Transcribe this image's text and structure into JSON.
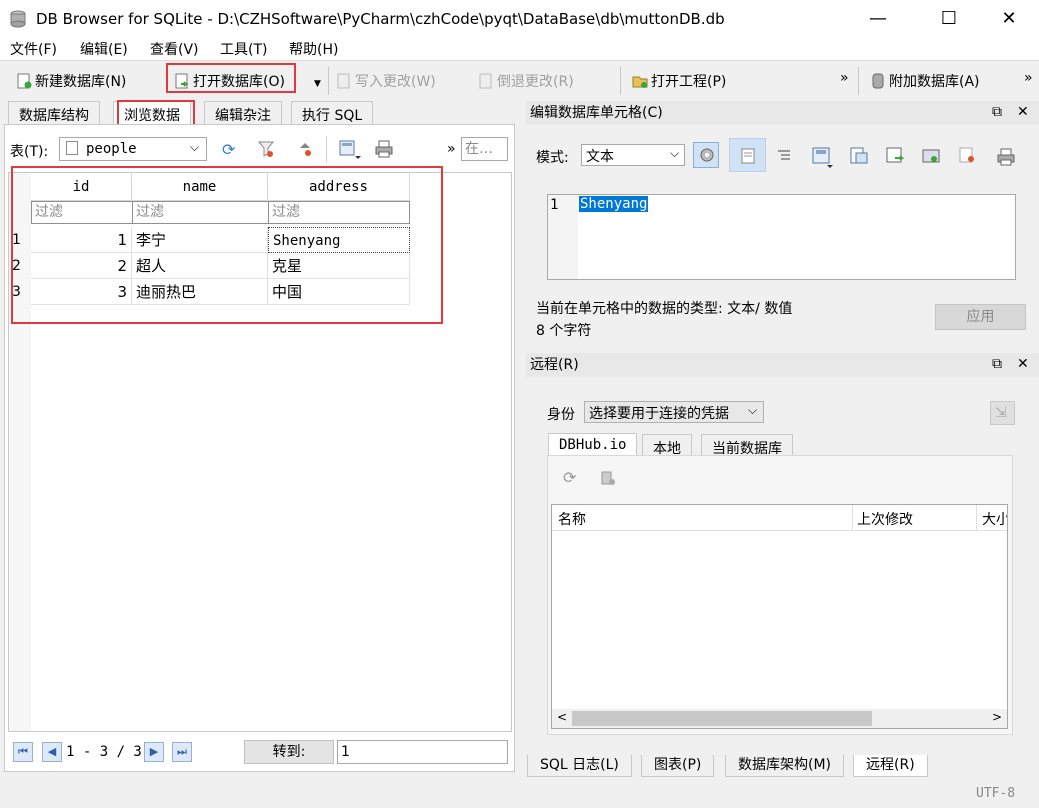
{
  "window": {
    "title": "DB Browser for SQLite - D:\\CZHSoftware\\PyCharm\\czhCode\\pyqt\\DataBase\\db\\muttonDB.db",
    "minimize": "—",
    "maximize": "☐",
    "close": "✕"
  },
  "menu": [
    "文件(F)",
    "编辑(E)",
    "查看(V)",
    "工具(T)",
    "帮助(H)"
  ],
  "toolbar": {
    "new_db": "新建数据库(N)",
    "open_db": "打开数据库(O)",
    "write_changes": "写入更改(W)",
    "revert_changes": "倒退更改(R)",
    "open_project": "打开工程(P)",
    "attach_db": "附加数据库(A)",
    "more": "»"
  },
  "main_tabs": [
    "数据库结构",
    "浏览数据",
    "编辑杂注",
    "执行 SQL"
  ],
  "browse": {
    "table_label": "表(T):",
    "table_selected": "people",
    "more": "»",
    "search_placeholder": "在…",
    "columns": [
      "id",
      "name",
      "address"
    ],
    "filter_placeholder": "过滤",
    "rows": [
      {
        "num": "1",
        "id": "1",
        "name": "李宁",
        "address": "Shenyang"
      },
      {
        "num": "2",
        "id": "2",
        "name": "超人",
        "address": "克星"
      },
      {
        "num": "3",
        "id": "3",
        "name": "迪丽热巴",
        "address": "中国"
      }
    ],
    "pagination": "1 - 3 / 3",
    "goto_label": "转到:",
    "goto_value": "1"
  },
  "edit_cell": {
    "title": "编辑数据库单元格(C)",
    "mode_label": "模式:",
    "mode_value": "文本",
    "line_number": "1",
    "content": "Shenyang",
    "type_info": "当前在单元格中的数据的类型: 文本/ 数值",
    "size_info": "8 个字符",
    "apply": "应用"
  },
  "remote": {
    "title": "远程(R)",
    "identity_label": "身份",
    "identity_value": "选择要用于连接的凭据",
    "tabs": [
      "DBHub.io",
      "本地",
      "当前数据库"
    ],
    "columns": [
      "名称",
      "上次修改",
      "大小"
    ]
  },
  "dock_ctrl": {
    "float": "⧉",
    "close": "✕"
  },
  "bottom_tabs": [
    "SQL 日志(L)",
    "图表(P)",
    "数据库架构(M)",
    "远程(R)"
  ],
  "status": {
    "encoding": "UTF-8"
  },
  "colors": {
    "highlight_box": "#e0393e",
    "selection": "#0078d7",
    "nav_blue": "#2d5fb0"
  }
}
